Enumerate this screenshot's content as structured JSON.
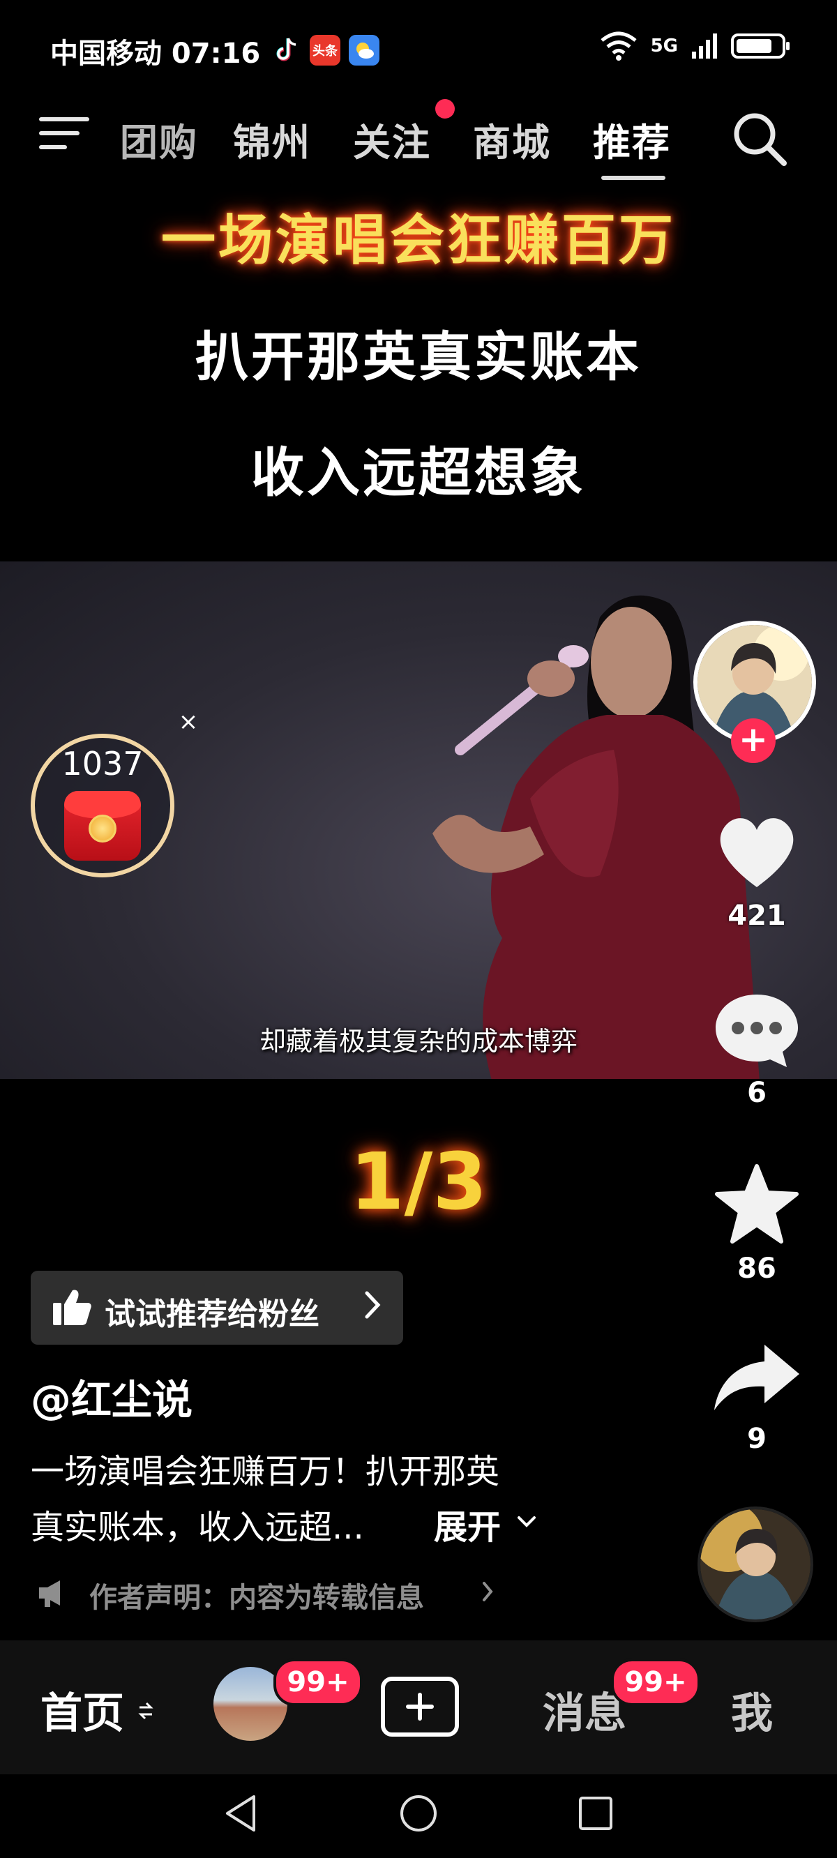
{
  "status_bar": {
    "carrier_time": "中国移动 07:16",
    "app_badge_toutiao": "头条",
    "network": "5G"
  },
  "top_nav": {
    "tabs": [
      {
        "label": "团购"
      },
      {
        "label": "锦州"
      },
      {
        "label": "关注"
      },
      {
        "label": "商城"
      },
      {
        "label": "推荐",
        "active": true
      }
    ]
  },
  "headline": {
    "line1": "一场演唱会狂赚百万",
    "line2": "扒开那英真实账本",
    "line3": "收入远超想象"
  },
  "video": {
    "subtitle": "却藏着极其复杂的成本博弈"
  },
  "red_packet": {
    "count": "1037",
    "close": "×"
  },
  "actions": {
    "likes": "421",
    "comments": "6",
    "favorites": "86",
    "shares": "9"
  },
  "page_counter": "1/3",
  "recommend_chip": {
    "label": "试试推荐给粉丝"
  },
  "post": {
    "author": "@红尘说",
    "desc_line1": "一场演唱会狂赚百万！扒开那英",
    "desc_line2": "真实账本，收入远超...",
    "expand": "展开",
    "statement": "作者声明：内容为转载信息"
  },
  "bottom_nav": {
    "home": "首页",
    "friends_badge": "99+",
    "messages": "消息",
    "messages_badge": "99+",
    "me": "我"
  },
  "colors": {
    "accent": "#fe2c55",
    "headline_yellow": "#f9e05c",
    "counter_yellow": "#f8d23c"
  }
}
